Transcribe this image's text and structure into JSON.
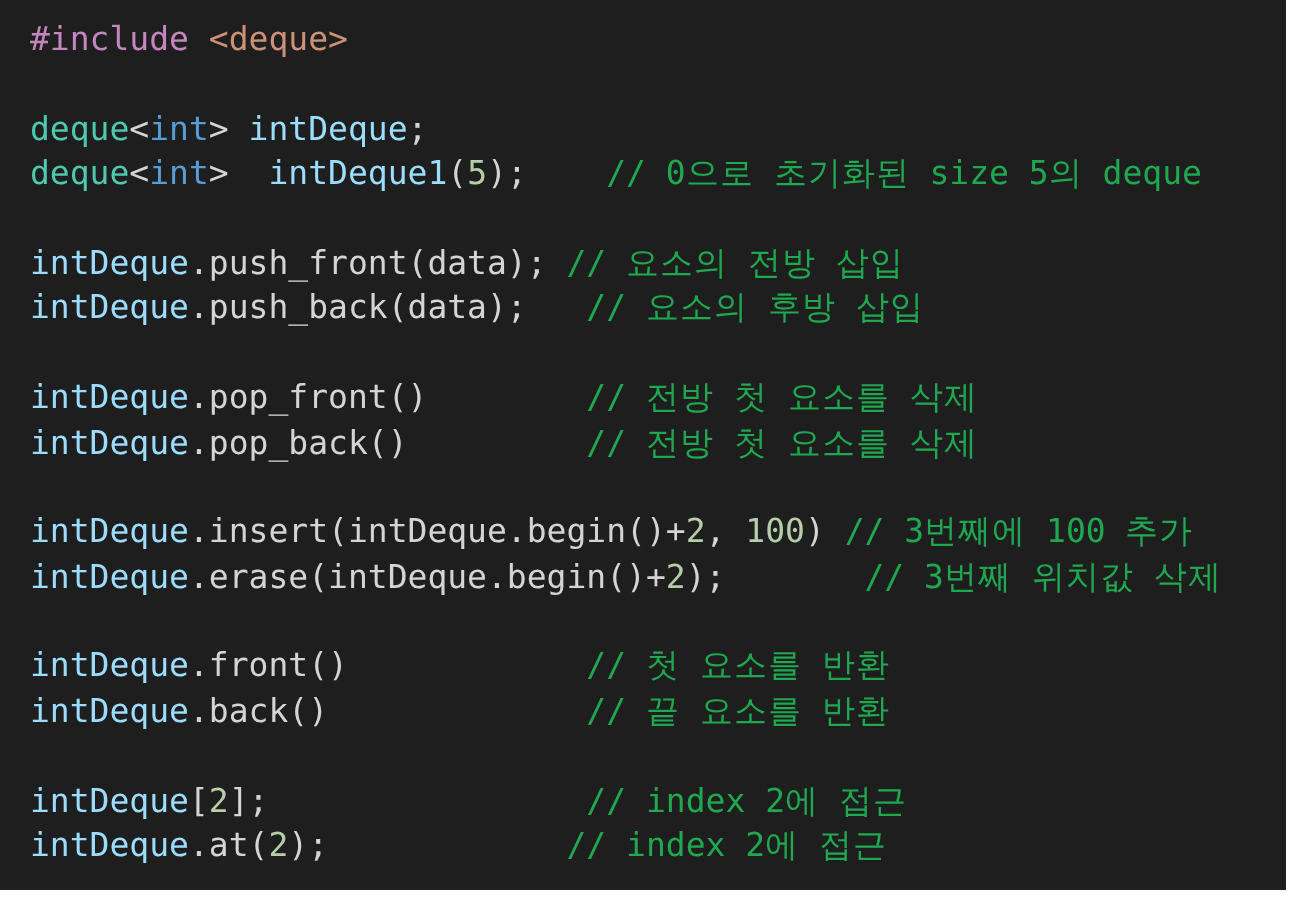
{
  "code_groups": [
    [
      {
        "tokens": [
          {
            "kind": "directive",
            "text": "#include "
          },
          {
            "kind": "header",
            "text": "<deque>"
          }
        ]
      }
    ],
    [
      {
        "tokens": [
          {
            "kind": "type",
            "text": "deque"
          },
          {
            "kind": "plain",
            "text": "<"
          },
          {
            "kind": "keyword",
            "text": "int"
          },
          {
            "kind": "plain",
            "text": "> "
          },
          {
            "kind": "ident",
            "text": "intDeque"
          },
          {
            "kind": "plain",
            "text": ";"
          }
        ]
      },
      {
        "tokens": [
          {
            "kind": "type",
            "text": "deque"
          },
          {
            "kind": "plain",
            "text": "<"
          },
          {
            "kind": "keyword",
            "text": "int"
          },
          {
            "kind": "plain",
            "text": ">  "
          },
          {
            "kind": "ident",
            "text": "intDeque1"
          },
          {
            "kind": "plain",
            "text": "("
          },
          {
            "kind": "number",
            "text": "5"
          },
          {
            "kind": "plain",
            "text": ");    "
          },
          {
            "kind": "comment",
            "text": "// 0으로 초기화된 size 5의 deque"
          }
        ]
      }
    ],
    [
      {
        "tokens": [
          {
            "kind": "ident",
            "text": "intDeque"
          },
          {
            "kind": "plain",
            "text": ".push_front(data); "
          },
          {
            "kind": "comment",
            "text": "// 요소의 전방 삽입"
          }
        ]
      },
      {
        "tokens": [
          {
            "kind": "ident",
            "text": "intDeque"
          },
          {
            "kind": "plain",
            "text": ".push_back(data);   "
          },
          {
            "kind": "comment",
            "text": "// 요소의 후방 삽입"
          }
        ]
      }
    ],
    [
      {
        "tokens": [
          {
            "kind": "ident",
            "text": "intDeque"
          },
          {
            "kind": "plain",
            "text": ".pop_front()        "
          },
          {
            "kind": "comment",
            "text": "// 전방 첫 요소를 삭제"
          }
        ]
      },
      {
        "tokens": [
          {
            "kind": "ident",
            "text": "intDeque"
          },
          {
            "kind": "plain",
            "text": ".pop_back()         "
          },
          {
            "kind": "comment",
            "text": "// 전방 첫 요소를 삭제"
          }
        ]
      }
    ],
    [
      {
        "tokens": [
          {
            "kind": "ident",
            "text": "intDeque"
          },
          {
            "kind": "plain",
            "text": ".insert(intDeque.begin()+"
          },
          {
            "kind": "number",
            "text": "2"
          },
          {
            "kind": "plain",
            "text": ", "
          },
          {
            "kind": "number",
            "text": "100"
          },
          {
            "kind": "plain",
            "text": ") "
          },
          {
            "kind": "comment",
            "text": "// 3번째에 100 추가"
          }
        ]
      },
      {
        "tokens": [
          {
            "kind": "ident",
            "text": "intDeque"
          },
          {
            "kind": "plain",
            "text": ".erase(intDeque.begin()+"
          },
          {
            "kind": "number",
            "text": "2"
          },
          {
            "kind": "plain",
            "text": ");       "
          },
          {
            "kind": "comment",
            "text": "// 3번째 위치값 삭제"
          }
        ]
      }
    ],
    [
      {
        "tokens": [
          {
            "kind": "ident",
            "text": "intDeque"
          },
          {
            "kind": "plain",
            "text": ".front()            "
          },
          {
            "kind": "comment",
            "text": "// 첫 요소를 반환"
          }
        ]
      },
      {
        "tokens": [
          {
            "kind": "ident",
            "text": "intDeque"
          },
          {
            "kind": "plain",
            "text": ".back()             "
          },
          {
            "kind": "comment",
            "text": "// 끝 요소를 반환"
          }
        ]
      }
    ],
    [
      {
        "tokens": [
          {
            "kind": "ident",
            "text": "intDeque"
          },
          {
            "kind": "plain",
            "text": "["
          },
          {
            "kind": "number",
            "text": "2"
          },
          {
            "kind": "plain",
            "text": "];                "
          },
          {
            "kind": "comment",
            "text": "// index 2에 접근"
          }
        ]
      },
      {
        "tokens": [
          {
            "kind": "ident",
            "text": "intDeque"
          },
          {
            "kind": "plain",
            "text": ".at("
          },
          {
            "kind": "number",
            "text": "2"
          },
          {
            "kind": "plain",
            "text": ");            "
          },
          {
            "kind": "comment",
            "text": "// index 2에 접근"
          }
        ]
      }
    ]
  ]
}
